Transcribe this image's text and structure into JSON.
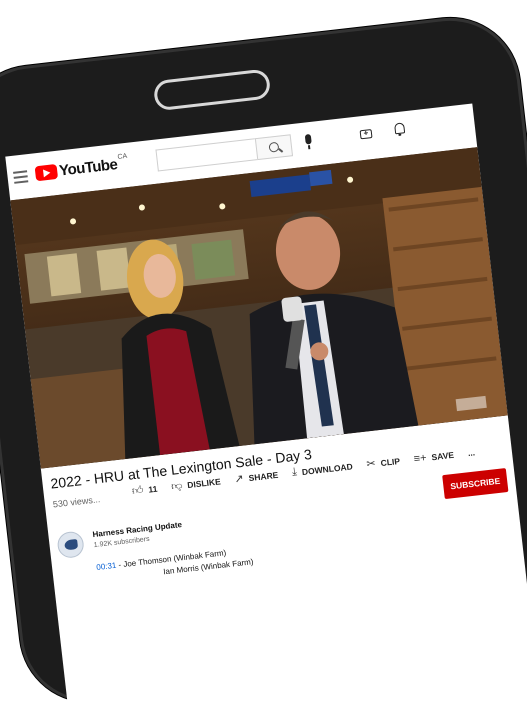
{
  "header": {
    "logo_text": "YouTube",
    "country_code": "CA"
  },
  "video": {
    "title": "2022 - HRU at The Lexington Sale - Day 3",
    "views": "530 views...",
    "likes": "11",
    "dislike_label": "DISLIKE",
    "share_label": "SHARE",
    "download_label": "DOWNLOAD",
    "clip_label": "CLIP",
    "save_label": "SAVE",
    "more_label": "..."
  },
  "channel": {
    "name": "Harness Racing Update",
    "subscribers": "1.92K subscribers",
    "subscribe_label": "SUBSCRIBE"
  },
  "chapters": [
    {
      "time": "00:31",
      "text": " - Joe Thomson (Winbak Farm)"
    },
    {
      "time": "",
      "text": "Ian Morris (Winbak Farm)"
    }
  ],
  "colors": {
    "brand": "#ff0000",
    "subscribe": "#cc0000",
    "link": "#065fd4",
    "phone": "#1c1c1c"
  },
  "icons": [
    "menu-icon",
    "youtube-logo-icon",
    "search-icon",
    "mic-icon",
    "create-icon",
    "bell-icon",
    "thumbs-up-icon",
    "thumbs-down-icon",
    "share-icon",
    "download-icon",
    "clip-icon",
    "save-icon"
  ]
}
